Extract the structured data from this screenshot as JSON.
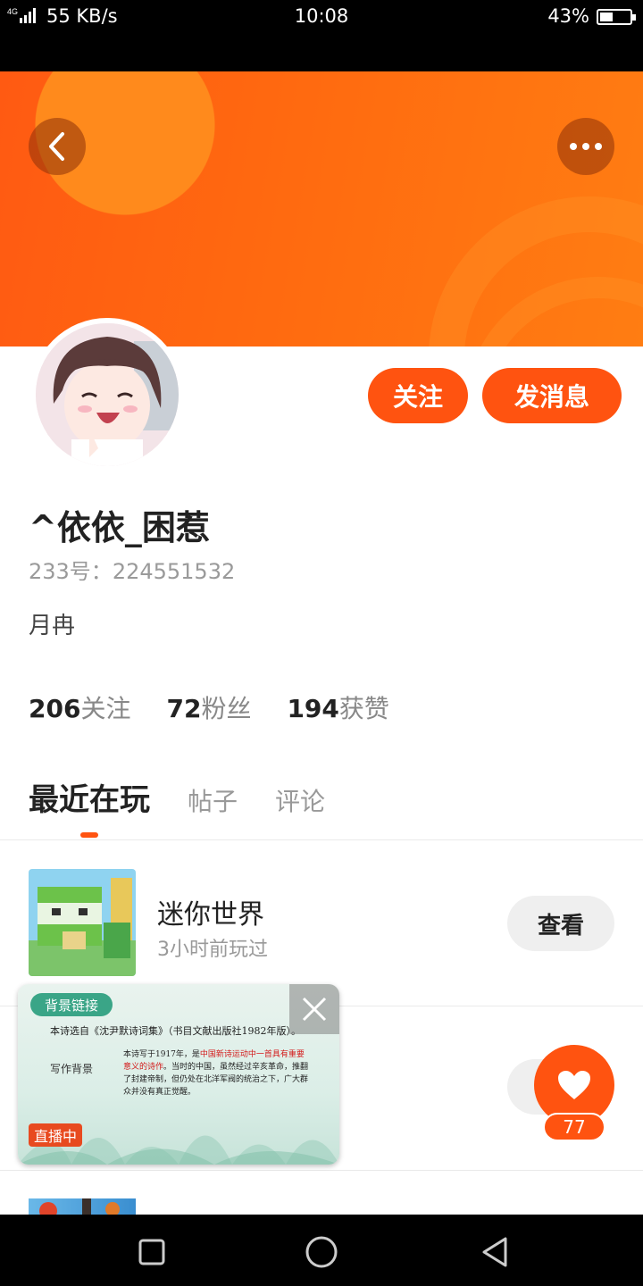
{
  "status_bar": {
    "signal": "4G",
    "net_speed": "55 KB/s",
    "time": "10:08",
    "battery": "43%",
    "battery_level": 0.43
  },
  "header": {
    "back_icon": "chevron-left-icon",
    "more_icon": "more-horizontal-icon",
    "banner_color": "#ff6a10"
  },
  "profile": {
    "follow_label": "关注",
    "message_label": "发消息",
    "username": "^依依_困惹",
    "id_label": "233号：",
    "id_value": "224551532",
    "bio": "月冉",
    "stats": [
      {
        "num": "206",
        "label": "关注"
      },
      {
        "num": "72",
        "label": "粉丝"
      },
      {
        "num": "194",
        "label": "获赞"
      }
    ]
  },
  "tabs": [
    {
      "label": "最近在玩",
      "active": true
    },
    {
      "label": "帖子",
      "active": false
    },
    {
      "label": "评论",
      "active": false
    }
  ],
  "games": [
    {
      "name": "迷你世界",
      "time": "3小时前玩过",
      "action": "查看"
    }
  ],
  "live_popup": {
    "tag": "背景链接",
    "line1": "本诗选自《沈尹默诗词集》（书目文献出版社1982年版）。",
    "side_label": "写作背景",
    "para_a": "本诗写于1917年，是",
    "para_red": "中国新诗运动中一首具有重要意义的诗作",
    "para_b": "。当时的中国，虽然经过辛亥革命，推翻了封建帝制，但仍处在北洋军阀的统治之下，广大群众并没有真正觉醒。",
    "live_badge": "直播中",
    "close_icon": "close-icon"
  },
  "like": {
    "icon": "heart-icon",
    "count": "77"
  },
  "nav": {
    "recent_icon": "square-icon",
    "home_icon": "circle-icon",
    "back_icon": "triangle-back-icon"
  },
  "colors": {
    "accent": "#ff5310",
    "live_tag": "#3aa587"
  }
}
